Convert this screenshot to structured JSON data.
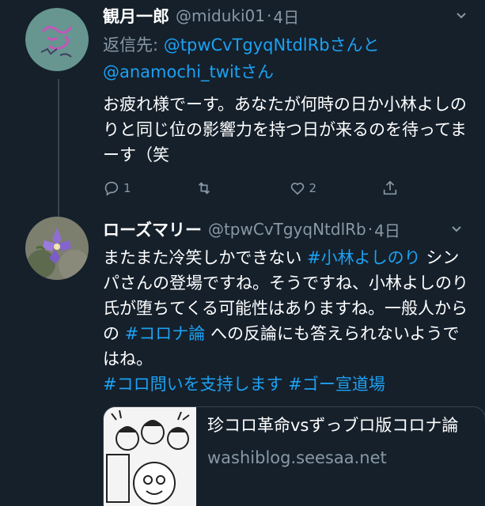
{
  "tweets": [
    {
      "display_name": "観月一郎",
      "handle": "@miduki01",
      "sep": "·",
      "time": "4日",
      "reply_prefix": "返信先: ",
      "reply_user1": "@tpwCvTgyqNtdlRb",
      "reply_joiner": "さんと",
      "reply_user2": "@anamochi_twit",
      "reply_suffix": "さん",
      "body": "お疲れ様でーす。あなたが何時の日か小林よしのりと同じ位の影響力を持つ日が来るのを待ってまーす（笑",
      "replies": "1",
      "retweets": "",
      "likes": "2"
    },
    {
      "display_name": "ローズマリー",
      "handle": "@tpwCvTgyqNtdlRb",
      "sep": "·",
      "time": "4日",
      "body_1": "またまた冷笑しかできない ",
      "hashtag_1": "#小林よしのり",
      "body_2": " シンパさんの登場ですね。そうですね、小林よしのり氏が堕ちてくる可能性はありますね。一般人からの ",
      "hashtag_2": "#コロナ論",
      "body_3": " への反論にも答えられないようではね。",
      "hashtag_3": "#コロ問いを支持します",
      "hashtag_4": "#ゴー宣道場",
      "card": {
        "title": "珍コロ革命vsずっブロ版コロナ論",
        "domain": "washiblog.seesaa.net"
      }
    }
  ],
  "icons": {
    "chevron": "chevron-down-icon",
    "reply": "reply-icon",
    "retweet": "retweet-icon",
    "like": "like-icon",
    "share": "share-icon"
  },
  "colors": {
    "background": "#15202b",
    "link": "#1da1f2",
    "secondary": "#8899a6",
    "border": "#38444d"
  }
}
